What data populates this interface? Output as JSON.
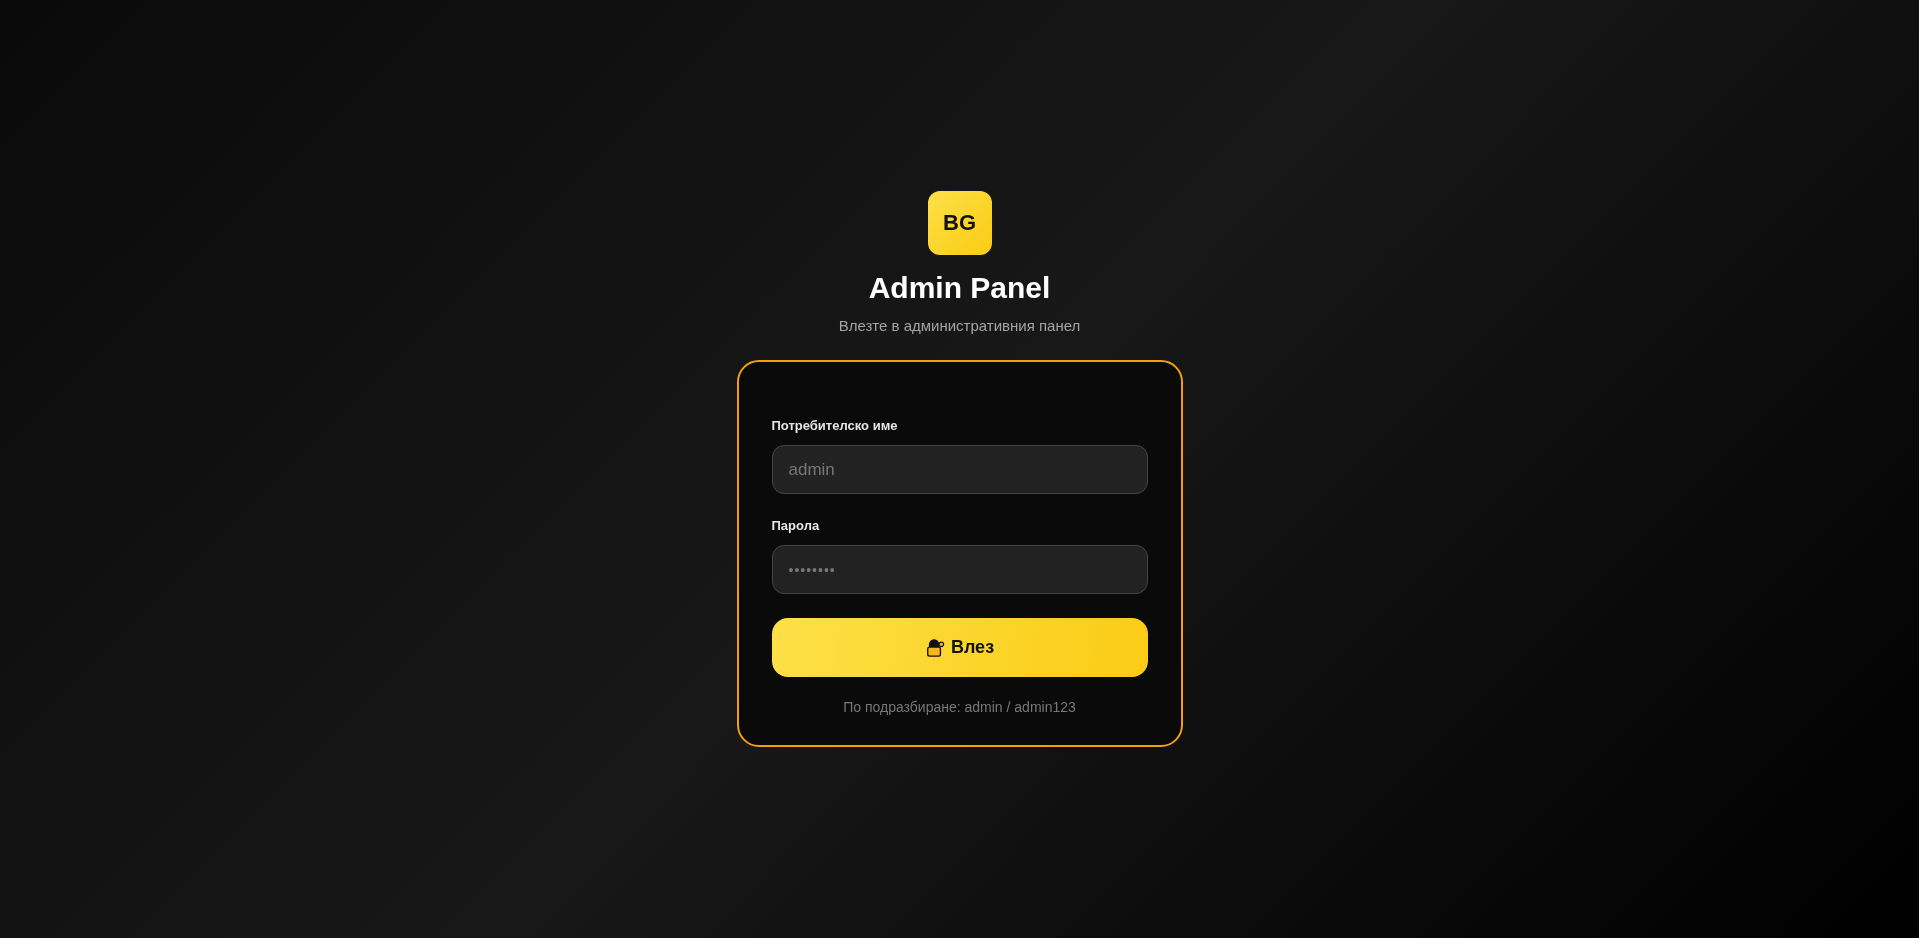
{
  "logo": {
    "text": "BG"
  },
  "title": "Admin Panel",
  "subtitle": "Влезте в административния панел",
  "fields": [
    {
      "label": "Потребителско име",
      "placeholder": "admin",
      "kind": "text"
    },
    {
      "label": "Парола",
      "placeholder": "••••••••",
      "kind": "password"
    }
  ],
  "button": {
    "label": "Влез"
  },
  "hint": "По подразбиране: admin / admin123"
}
